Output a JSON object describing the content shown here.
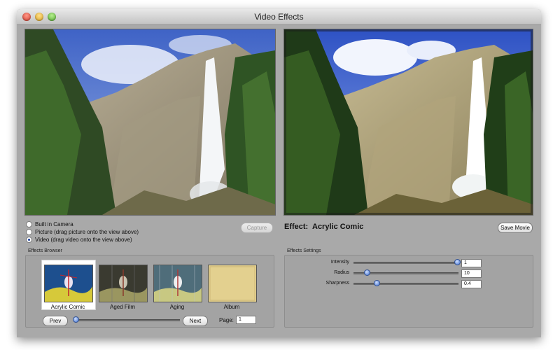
{
  "window": {
    "title": "Video Effects"
  },
  "source": {
    "options": [
      {
        "label": "Built in Camera",
        "selected": false
      },
      {
        "label": "Picture (drag picture onto the view above)",
        "selected": false
      },
      {
        "label": "Video (drag video onto the view above)",
        "selected": true
      }
    ],
    "capture_label": "Capture"
  },
  "effect": {
    "label": "Effect:",
    "name": "Acrylic Comic",
    "save_label": "Save Movie"
  },
  "browser": {
    "title": "Effects Browser",
    "items": [
      {
        "label": "Acrylic Comic",
        "selected": true
      },
      {
        "label": "Aged Film",
        "selected": false
      },
      {
        "label": "Aging",
        "selected": false
      },
      {
        "label": "Album",
        "selected": false
      }
    ],
    "prev_label": "Prev",
    "next_label": "Next",
    "page_label": "Page:",
    "page_value": "1"
  },
  "settings": {
    "title": "Effects Settings",
    "params": [
      {
        "label": "Intensity",
        "value": "1"
      },
      {
        "label": "Radius",
        "value": "10"
      },
      {
        "label": "Sharpness",
        "value": "0.4"
      }
    ]
  },
  "colors": {
    "window_bg": "#a9a9a9",
    "knob_blue": "#3f6fcf"
  }
}
